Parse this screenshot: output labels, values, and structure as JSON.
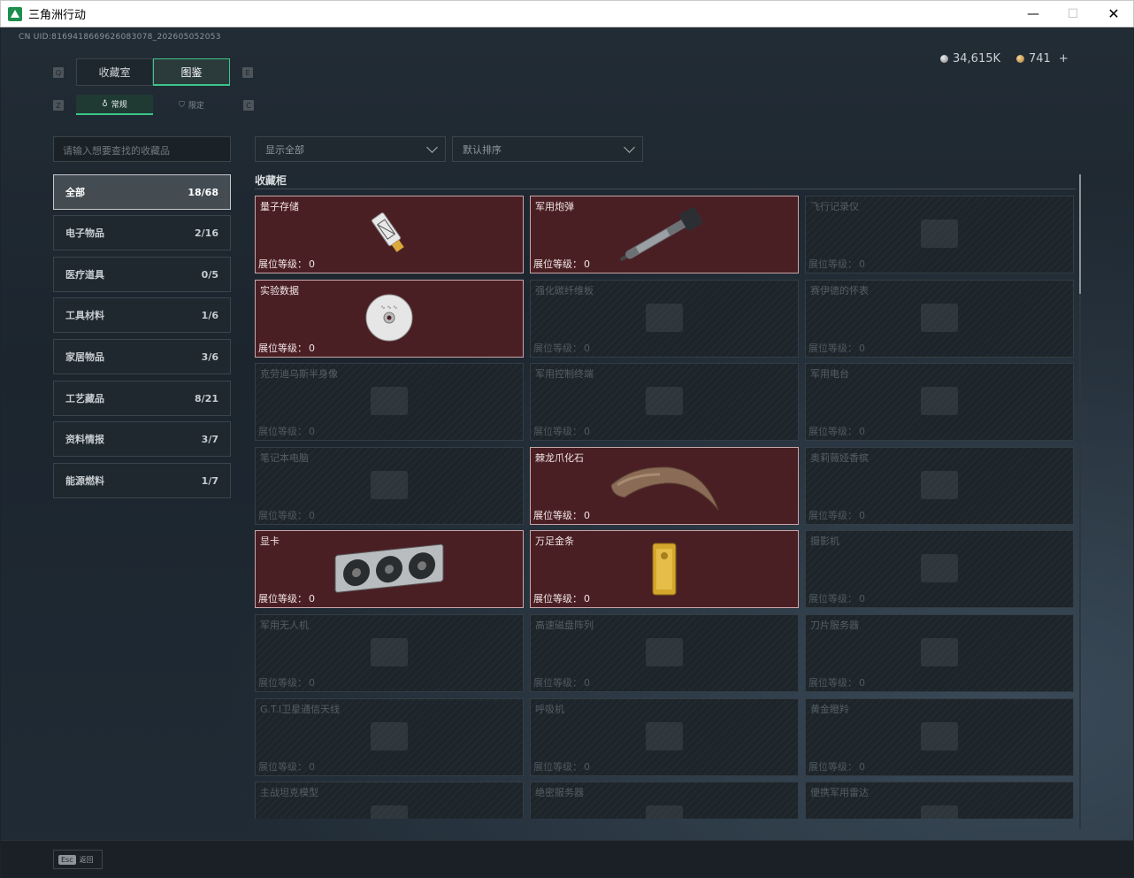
{
  "window": {
    "title": "三角洲行动"
  },
  "uid": "CN UID:8169418669626083078_202605052053",
  "currency": {
    "silver": "34,615K",
    "gold": "741",
    "plus": "+"
  },
  "tabs": {
    "main": [
      "收藏室",
      "图鉴"
    ],
    "sub": [
      "常规",
      "限定"
    ],
    "hint_left": "Q",
    "hint_right": "E",
    "sub_hint_left": "Z",
    "sub_hint_right": "C"
  },
  "search": {
    "placeholder": "请输入想要查找的收藏品"
  },
  "categories": [
    {
      "label": "全部",
      "count": "18/68"
    },
    {
      "label": "电子物品",
      "count": "2/16"
    },
    {
      "label": "医疗道具",
      "count": "0/5"
    },
    {
      "label": "工具材料",
      "count": "1/6"
    },
    {
      "label": "家居物品",
      "count": "3/6"
    },
    {
      "label": "工艺藏品",
      "count": "8/21"
    },
    {
      "label": "资料情报",
      "count": "3/7"
    },
    {
      "label": "能源燃料",
      "count": "1/7"
    }
  ],
  "filters": {
    "show": "显示全部",
    "sort": "默认排序"
  },
  "section": {
    "title": "收藏柜"
  },
  "level_label": "展位等级：",
  "items": [
    {
      "name": "量子存储",
      "level": "0",
      "owned": true,
      "icon": "usb-drive-icon"
    },
    {
      "name": "军用炮弹",
      "level": "0",
      "owned": true,
      "icon": "artillery-shell-icon"
    },
    {
      "name": "飞行记录仪",
      "level": "0",
      "owned": false,
      "icon": "flight-recorder-icon"
    },
    {
      "name": "实验数据",
      "level": "0",
      "owned": true,
      "icon": "cd-disc-icon"
    },
    {
      "name": "强化碳纤维板",
      "level": "0",
      "owned": false,
      "icon": "carbon-plate-icon"
    },
    {
      "name": "赛伊德的怀表",
      "level": "0",
      "owned": false,
      "icon": "pocket-watch-icon"
    },
    {
      "name": "克劳迪乌斯半身像",
      "level": "0",
      "owned": false,
      "icon": "bust-icon"
    },
    {
      "name": "军用控制终端",
      "level": "0",
      "owned": false,
      "icon": "terminal-icon"
    },
    {
      "name": "军用电台",
      "level": "0",
      "owned": false,
      "icon": "radio-icon"
    },
    {
      "name": "笔记本电脑",
      "level": "0",
      "owned": false,
      "icon": "laptop-icon"
    },
    {
      "name": "棘龙爪化石",
      "level": "0",
      "owned": true,
      "icon": "claw-fossil-icon"
    },
    {
      "name": "奥莉薇娅香槟",
      "level": "0",
      "owned": false,
      "icon": "champagne-icon"
    },
    {
      "name": "显卡",
      "level": "0",
      "owned": true,
      "icon": "graphics-card-icon"
    },
    {
      "name": "万足金条",
      "level": "0",
      "owned": true,
      "icon": "gold-bar-icon"
    },
    {
      "name": "摄影机",
      "level": "0",
      "owned": false,
      "icon": "camera-icon"
    },
    {
      "name": "军用无人机",
      "level": "0",
      "owned": false,
      "icon": "drone-icon"
    },
    {
      "name": "高速磁盘阵列",
      "level": "0",
      "owned": false,
      "icon": "disk-array-icon"
    },
    {
      "name": "刀片服务器",
      "level": "0",
      "owned": false,
      "icon": "blade-server-icon"
    },
    {
      "name": "G.T.I卫星通信天线",
      "level": "0",
      "owned": false,
      "icon": "satellite-dish-icon"
    },
    {
      "name": "呼吸机",
      "level": "0",
      "owned": false,
      "icon": "ventilator-icon"
    },
    {
      "name": "黄金瞪羚",
      "level": "0",
      "owned": false,
      "icon": "gazelle-statue-icon"
    },
    {
      "name": "主战坦克模型",
      "level": "",
      "owned": false,
      "icon": "tank-model-icon"
    },
    {
      "name": "绝密服务器",
      "level": "",
      "owned": false,
      "icon": "server-icon"
    },
    {
      "name": "便携军用雷达",
      "level": "",
      "owned": false,
      "icon": "radar-icon"
    }
  ],
  "bottom": {
    "esc_key": "Esc",
    "esc_label": "返回"
  },
  "colors": {
    "accent": "#3cc68a",
    "owned_bg": "#4a1f24",
    "owned_border": "#c8a6a8"
  }
}
